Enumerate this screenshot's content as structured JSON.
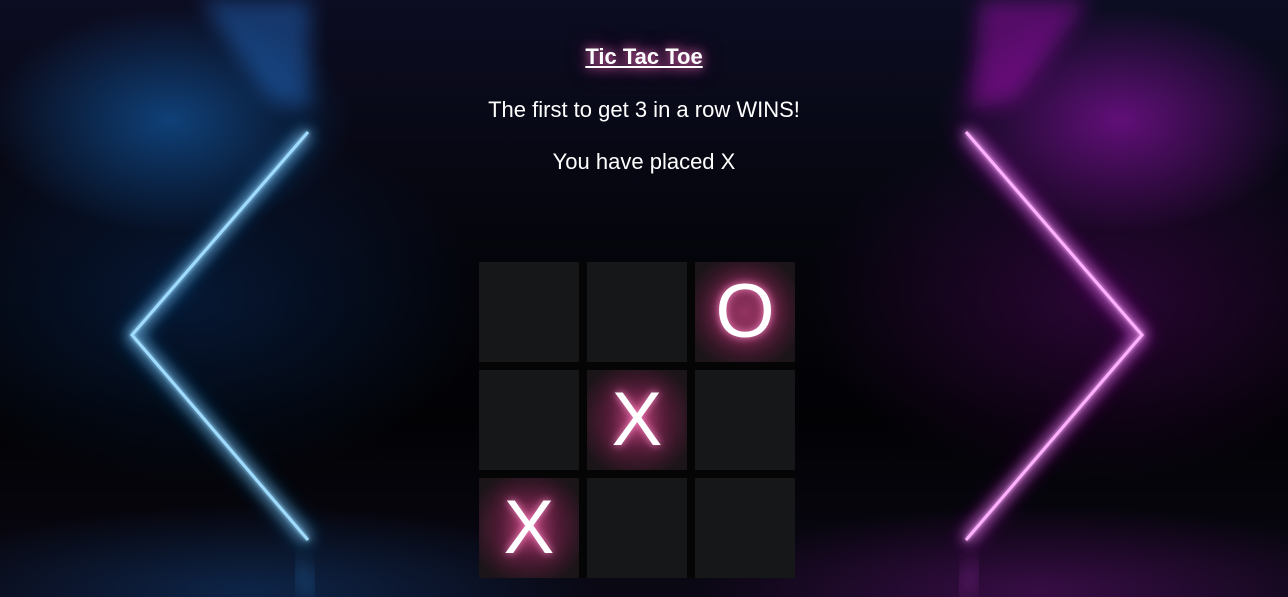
{
  "game": {
    "title": "Tic Tac Toe",
    "subtitle": "The first to get 3 in a row WINS!",
    "status": "You have placed X"
  },
  "board": {
    "cells": [
      "",
      "",
      "O",
      "",
      "X",
      "",
      "X",
      "",
      ""
    ]
  },
  "colors": {
    "neon_left": "#1ea0ff",
    "neon_right": "#e000f0",
    "cell_background": "#161719",
    "mark_glow": "#ff69b4"
  }
}
